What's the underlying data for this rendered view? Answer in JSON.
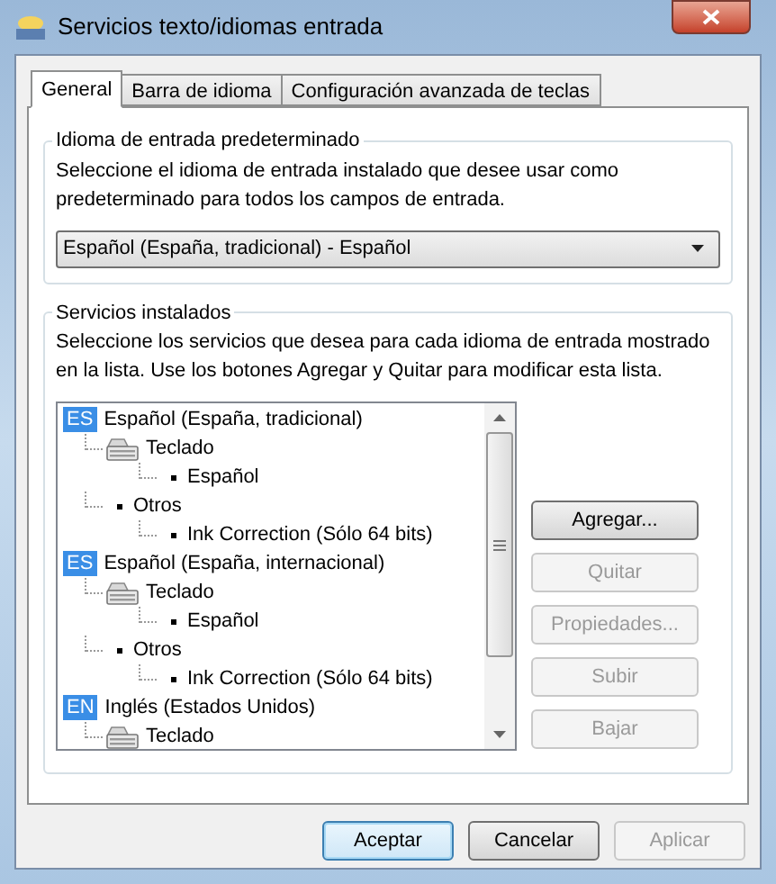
{
  "window": {
    "title": "Servicios texto/idiomas entrada"
  },
  "tabs": [
    {
      "label": "General",
      "selected": true
    },
    {
      "label": "Barra de idioma",
      "selected": false
    },
    {
      "label": "Configuración avanzada de teclas",
      "selected": false
    }
  ],
  "default_language": {
    "title": "Idioma de entrada predeterminado",
    "description": "Seleccione el idioma de entrada instalado que desee usar como predeterminado para todos los campos de entrada.",
    "dropdown": {
      "value": "Español (España, tradicional) - Español"
    }
  },
  "installed_services": {
    "title": "Servicios instalados",
    "description": "Seleccione los servicios que desea para cada idioma de entrada mostrado en la lista. Use los botones Agregar y Quitar para modificar esta lista.",
    "tree": [
      {
        "kind": "language",
        "badge": "ES",
        "label": "Español (España, tradicional)",
        "children": [
          {
            "kind": "keyboard",
            "label": "Teclado",
            "children": [
              {
                "kind": "bullet",
                "label": "Español"
              }
            ]
          },
          {
            "kind": "bullet",
            "label": "Otros",
            "children": [
              {
                "kind": "bullet",
                "label": "Ink Correction (Sólo 64 bits)"
              }
            ]
          }
        ]
      },
      {
        "kind": "language",
        "badge": "ES",
        "label": "Español (España, internacional)",
        "children": [
          {
            "kind": "keyboard",
            "label": "Teclado",
            "children": [
              {
                "kind": "bullet",
                "label": "Español"
              }
            ]
          },
          {
            "kind": "bullet",
            "label": "Otros",
            "children": [
              {
                "kind": "bullet",
                "label": "Ink Correction (Sólo 64 bits)"
              }
            ]
          }
        ]
      },
      {
        "kind": "language",
        "badge": "EN",
        "label": "Inglés (Estados Unidos)",
        "children": [
          {
            "kind": "keyboard",
            "label": "Teclado"
          }
        ]
      }
    ],
    "buttons": [
      {
        "label": "Agregar...",
        "disabled": false
      },
      {
        "label": "Quitar",
        "disabled": true
      },
      {
        "label": "Propiedades...",
        "disabled": true
      },
      {
        "label": "Subir",
        "disabled": true
      },
      {
        "label": "Bajar",
        "disabled": true
      }
    ]
  },
  "footer_buttons": [
    {
      "label": "Aceptar",
      "disabled": false,
      "default": true
    },
    {
      "label": "Cancelar",
      "disabled": false,
      "default": false
    },
    {
      "label": "Aplicar",
      "disabled": true,
      "default": false
    }
  ]
}
